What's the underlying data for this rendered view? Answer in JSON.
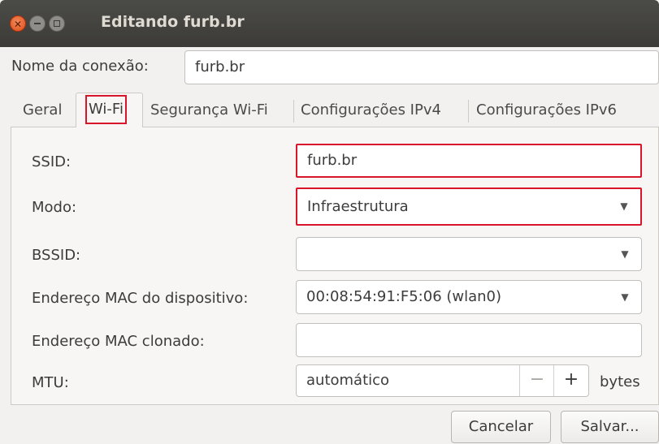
{
  "window": {
    "title": "Editando furb.br"
  },
  "connection": {
    "name_label": "Nome da conexão:",
    "name_value": "furb.br"
  },
  "tabs": [
    {
      "label": "Geral"
    },
    {
      "label": "Wi-Fi"
    },
    {
      "label": "Segurança Wi-Fi"
    },
    {
      "label": "Configurações IPv4"
    },
    {
      "label": "Configurações IPv6"
    }
  ],
  "wifi": {
    "ssid_label": "SSID:",
    "ssid_value": "furb.br",
    "mode_label": "Modo:",
    "mode_value": "Infraestrutura",
    "bssid_label": "BSSID:",
    "bssid_value": "",
    "mac_label": "Endereço MAC do dispositivo:",
    "mac_value": "00:08:54:91:F5:06 (wlan0)",
    "cloned_mac_label": "Endereço MAC clonado:",
    "cloned_mac_value": "",
    "mtu_label": "MTU:",
    "mtu_value": "automático",
    "mtu_unit": "bytes",
    "minus": "−",
    "plus": "+"
  },
  "buttons": {
    "cancel": "Cancelar",
    "save": "Salvar..."
  },
  "colors": {
    "highlight": "#d8152a",
    "titlebar": "#3c3b37"
  }
}
